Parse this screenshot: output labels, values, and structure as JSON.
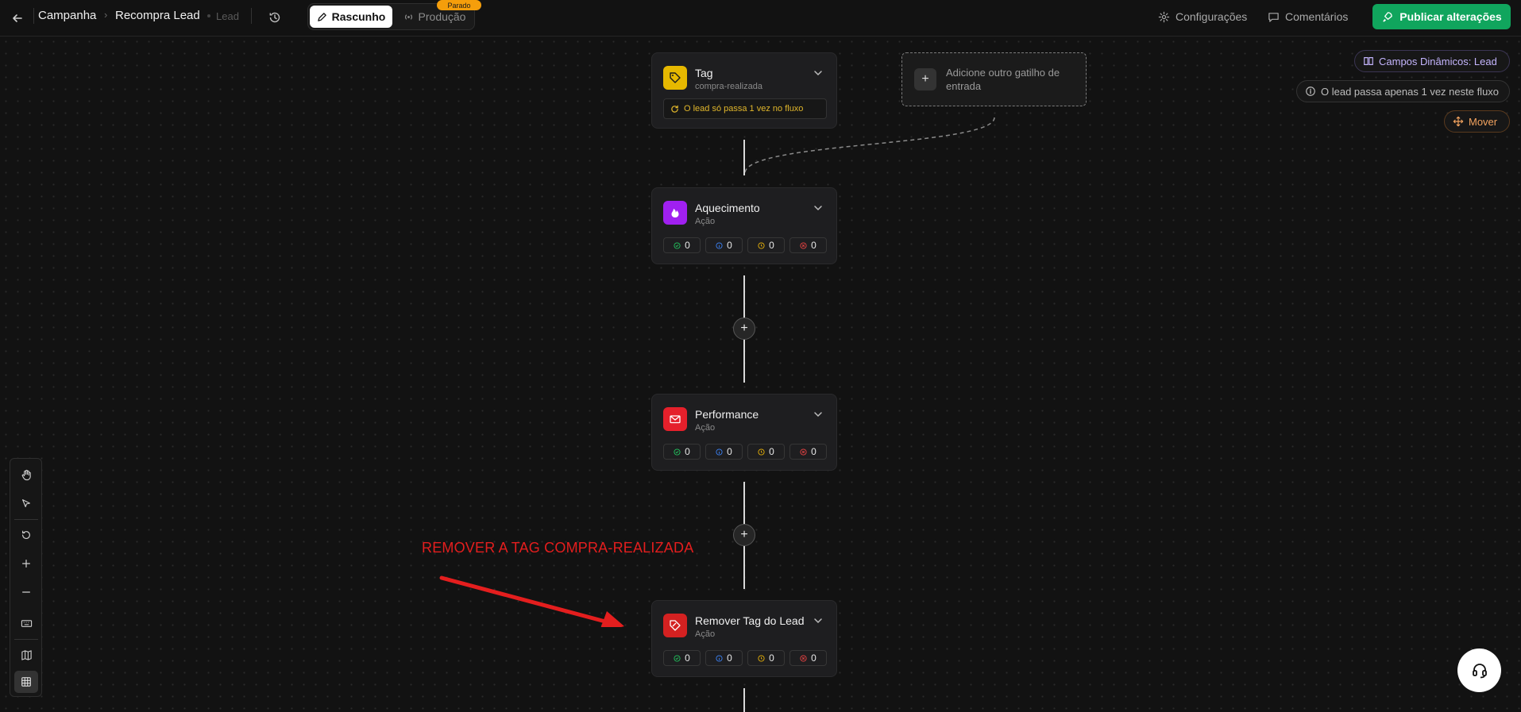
{
  "header": {
    "breadcrumb": {
      "campaign": "Campanha",
      "flow": "Recompra Lead",
      "type": "Lead"
    },
    "modes": {
      "draft": "Rascunho",
      "production": "Produção",
      "production_badge": "Parado"
    },
    "settings": "Configurações",
    "comments": "Comentários",
    "publish": "Publicar alterações"
  },
  "pills": {
    "dynamic_fields": "Campos Dinâmicos: Lead",
    "info": "O lead passa apenas 1 vez neste fluxo",
    "move": "Mover"
  },
  "add_trigger": "Adicione outro gatilho de entrada",
  "nodes": [
    {
      "title": "Tag",
      "subtitle": "compra-realizada",
      "note": "O lead só passa 1 vez no fluxo",
      "icon": "tag-icon",
      "color": "#e6b800"
    },
    {
      "title": "Aquecimento",
      "subtitle": "Ação",
      "icon": "flame-icon",
      "color": "#a020f0",
      "stats": [
        "0",
        "0",
        "0",
        "0"
      ]
    },
    {
      "title": "Performance",
      "subtitle": "Ação",
      "icon": "mail-icon",
      "color": "#e5202b",
      "stats": [
        "0",
        "0",
        "0",
        "0"
      ]
    },
    {
      "title": "Remover Tag do Lead",
      "subtitle": "Ação",
      "icon": "tag-remove-icon",
      "color": "#d42121",
      "stats": [
        "0",
        "0",
        "0",
        "0"
      ]
    }
  ],
  "annotation": "REMOVER A TAG COMPRA-REALIZADA",
  "colors": {
    "stat_success": "#22c55e",
    "stat_info": "#3b82f6",
    "stat_pending": "#eab308",
    "stat_error": "#ef4444",
    "publish": "#10a55d"
  }
}
